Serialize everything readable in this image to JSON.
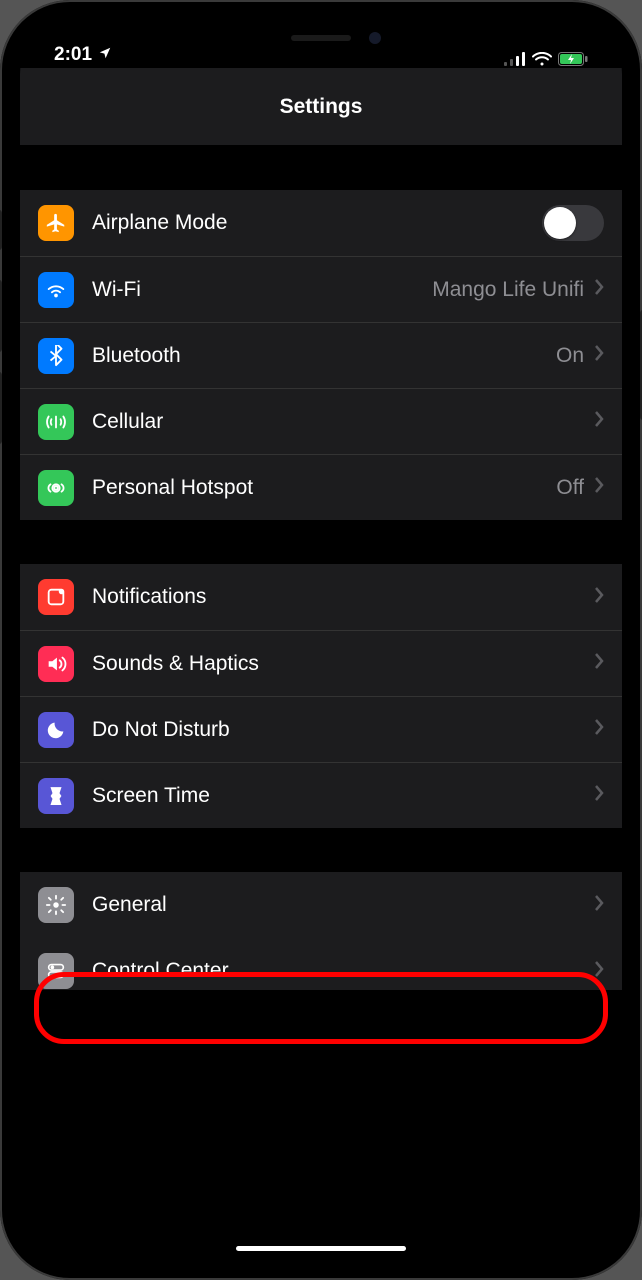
{
  "status": {
    "time": "2:01"
  },
  "header": {
    "title": "Settings"
  },
  "group1": {
    "airplane": {
      "label": "Airplane Mode",
      "on": false
    },
    "wifi": {
      "label": "Wi-Fi",
      "value": "Mango Life Unifi"
    },
    "bluetooth": {
      "label": "Bluetooth",
      "value": "On"
    },
    "cellular": {
      "label": "Cellular"
    },
    "hotspot": {
      "label": "Personal Hotspot",
      "value": "Off"
    }
  },
  "group2": {
    "notifications": {
      "label": "Notifications"
    },
    "sounds": {
      "label": "Sounds & Haptics"
    },
    "dnd": {
      "label": "Do Not Disturb"
    },
    "screentime": {
      "label": "Screen Time"
    }
  },
  "group3": {
    "general": {
      "label": "General"
    },
    "controlcenter": {
      "label": "Control Center"
    }
  }
}
